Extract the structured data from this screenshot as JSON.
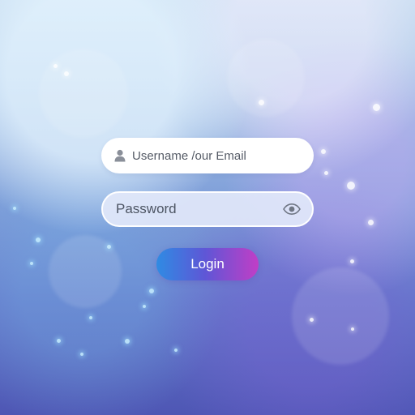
{
  "login_form": {
    "username_placeholder": "Username /our Email",
    "password_placeholder": "Password",
    "login_label": "Login",
    "user_icon": "user-icon",
    "password_visibility_icon": "eye-icon"
  },
  "colors": {
    "background_top": "#c6dcf0",
    "background_bottom": "#4e56b4",
    "button_gradient_start": "#2f8be3",
    "button_gradient_end": "#c13ec6",
    "field_background": "#ffffff"
  }
}
